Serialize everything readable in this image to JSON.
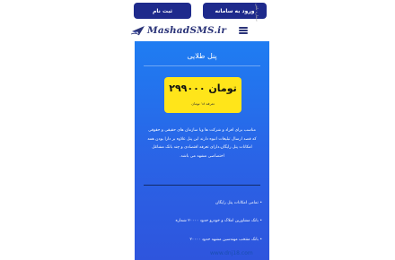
{
  "top_buttons": {
    "register_label": "ثبت نام",
    "login_label": "ورود به سامانه"
  },
  "side_text": "شماره تلفن",
  "header": {
    "logo_text": "MashadSMS.ir",
    "logo_icon": "plane-icon",
    "menu_icon": "hamburger-menu-icon"
  },
  "plan": {
    "title": "پنل طلایی",
    "price": "۲۹۹۰۰۰ تومان",
    "price_note": "تعرفه ۱۸ تومان",
    "description": "مناسب برای افراد و شرکت ها ویا سازمان های حقیقی و حقوقی که قصد ارسال تبلیغات انبوه دارند این پنل علاوه بر دارا بودن همه امکانات پنل رایگان،دارای تعرفه اقتصادی و چند بانک مشاغل اختصاصی مشهد می باشد.",
    "features": [
      "• تمامی امکانات پنل رایگان",
      "• بانک مشاورین املاک و خودرو حدود ۲۰۰۰۰ شماره",
      "• بانک منتخب مهندسین مشهد حدود ۲۰۰۰۰"
    ]
  },
  "colors": {
    "nav_button": "#1e2a8c",
    "card_top": "#1f7df2",
    "card_bottom": "#2e55dd",
    "price_box": "#ffe51a",
    "logo": "#2a3378"
  },
  "watermark": "www.dnj18.com"
}
